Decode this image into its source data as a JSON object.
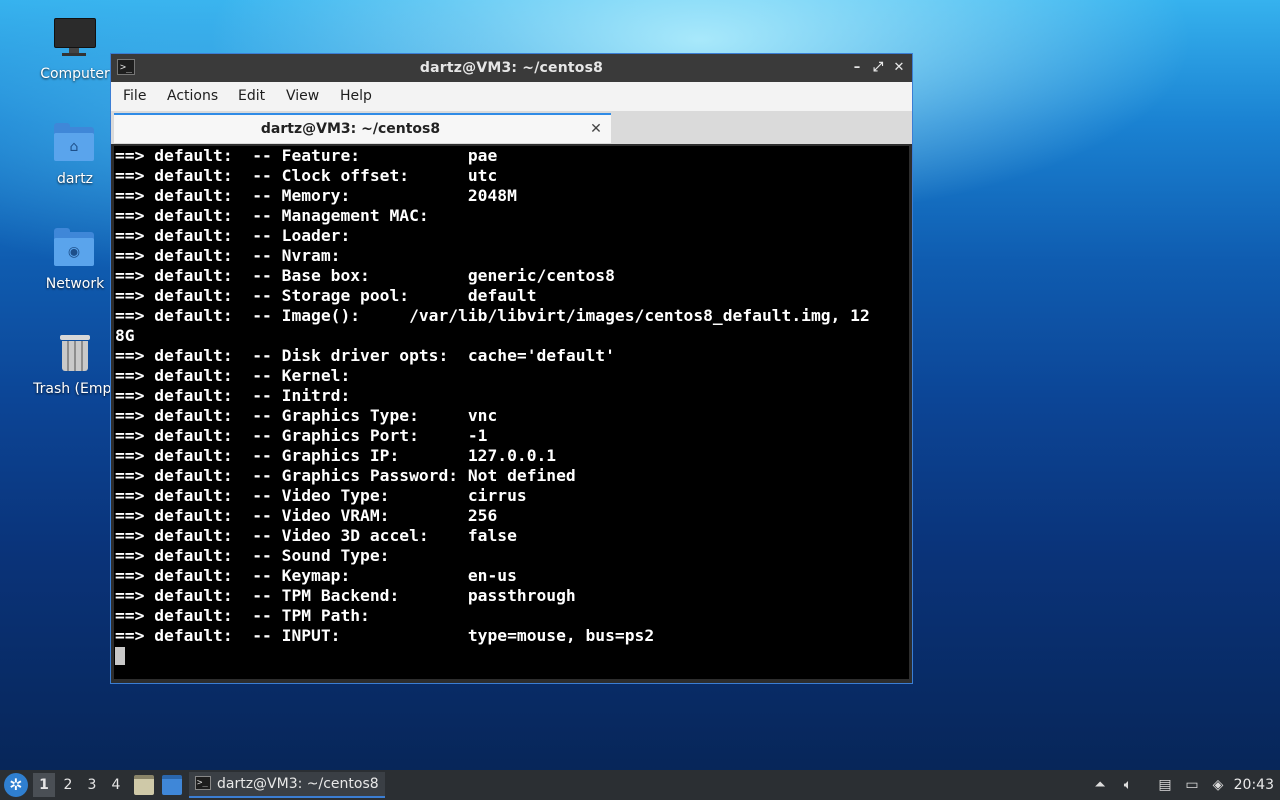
{
  "desktop": {
    "icons": [
      {
        "label": "Computer",
        "icon": "computer-icon"
      },
      {
        "label": "dartz",
        "icon": "home-folder-icon"
      },
      {
        "label": "Network",
        "icon": "network-folder-icon"
      },
      {
        "label": "Trash (Empt",
        "icon": "trash-icon"
      }
    ]
  },
  "window": {
    "title": "dartz@VM3: ~/centos8",
    "buttons": {
      "minimize": "–",
      "maximize": "⤢",
      "close": "✕"
    },
    "menu": [
      "File",
      "Actions",
      "Edit",
      "View",
      "Help"
    ],
    "tab": {
      "label": "dartz@VM3: ~/centos8",
      "close": "✕"
    },
    "terminal_lines": [
      "==> default:  -- Feature:           pae",
      "==> default:  -- Clock offset:      utc",
      "==> default:  -- Memory:            2048M",
      "==> default:  -- Management MAC:",
      "==> default:  -- Loader:",
      "==> default:  -- Nvram:",
      "==> default:  -- Base box:          generic/centos8",
      "==> default:  -- Storage pool:      default",
      "==> default:  -- Image():     /var/lib/libvirt/images/centos8_default.img, 12",
      "8G",
      "==> default:  -- Disk driver opts:  cache='default'",
      "==> default:  -- Kernel:",
      "==> default:  -- Initrd:",
      "==> default:  -- Graphics Type:     vnc",
      "==> default:  -- Graphics Port:     -1",
      "==> default:  -- Graphics IP:       127.0.0.1",
      "==> default:  -- Graphics Password: Not defined",
      "==> default:  -- Video Type:        cirrus",
      "==> default:  -- Video VRAM:        256",
      "==> default:  -- Video 3D accel:    false",
      "==> default:  -- Sound Type:",
      "==> default:  -- Keymap:            en-us",
      "==> default:  -- TPM Backend:       passthrough",
      "==> default:  -- TPM Path:",
      "==> default:  -- INPUT:             type=mouse, bus=ps2"
    ]
  },
  "taskbar": {
    "workspaces": [
      "1",
      "2",
      "3",
      "4"
    ],
    "active_workspace": "1",
    "task_label": "dartz@VM3: ~/centos8",
    "clock": "20:43"
  },
  "colors": {
    "accent": "#3b7ed4",
    "terminal_bg": "#000000",
    "terminal_fg": "#ffffff"
  }
}
